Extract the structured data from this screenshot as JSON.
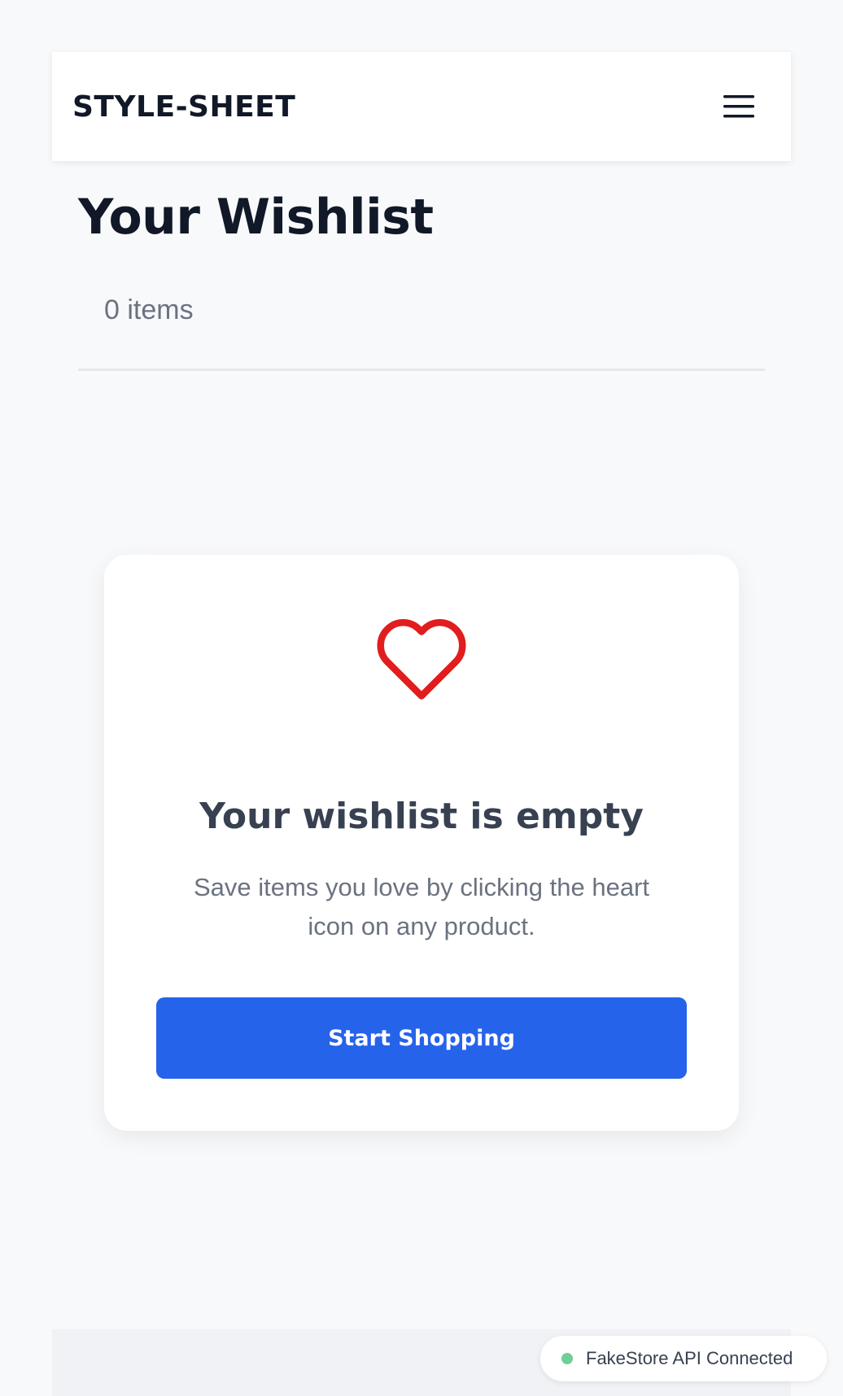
{
  "navbar": {
    "logo": "STYLE-SHEET",
    "menu_icon": "hamburger-menu-icon"
  },
  "main": {
    "title": "Your Wishlist",
    "item_count": "0 items"
  },
  "empty_state": {
    "icon": "heart-outline-icon",
    "heart_color": "#e11d1d",
    "title": "Your wishlist is empty",
    "description": "Save items you love by clicking the heart icon on any product.",
    "button_label": "Start Shopping"
  },
  "status": {
    "text": "FakeStore API Connected",
    "indicator_color": "#6fcf97"
  },
  "colors": {
    "accent": "#2563eb",
    "background": "#f8f9fb"
  }
}
